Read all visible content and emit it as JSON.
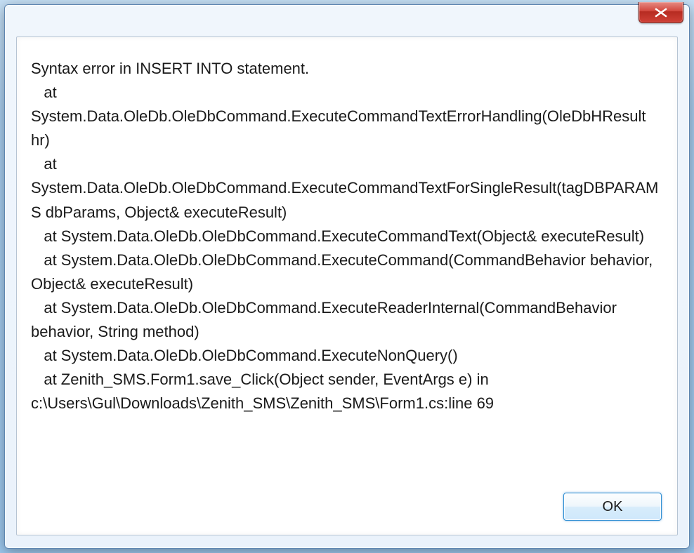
{
  "dialog": {
    "message": "Syntax error in INSERT INTO statement.\n   at System.Data.OleDb.OleDbCommand.ExecuteCommandTextErrorHandling(OleDbHResult hr)\n   at System.Data.OleDb.OleDbCommand.ExecuteCommandTextForSingleResult(tagDBPARAMS dbParams, Object& executeResult)\n   at System.Data.OleDb.OleDbCommand.ExecuteCommandText(Object& executeResult)\n   at System.Data.OleDb.OleDbCommand.ExecuteCommand(CommandBehavior behavior, Object& executeResult)\n   at System.Data.OleDb.OleDbCommand.ExecuteReaderInternal(CommandBehavior behavior, String method)\n   at System.Data.OleDb.OleDbCommand.ExecuteNonQuery()\n   at Zenith_SMS.Form1.save_Click(Object sender, EventArgs e) in c:\\Users\\Gul\\Downloads\\Zenith_SMS\\Zenith_SMS\\Form1.cs:line 69",
    "ok_label": "OK"
  }
}
